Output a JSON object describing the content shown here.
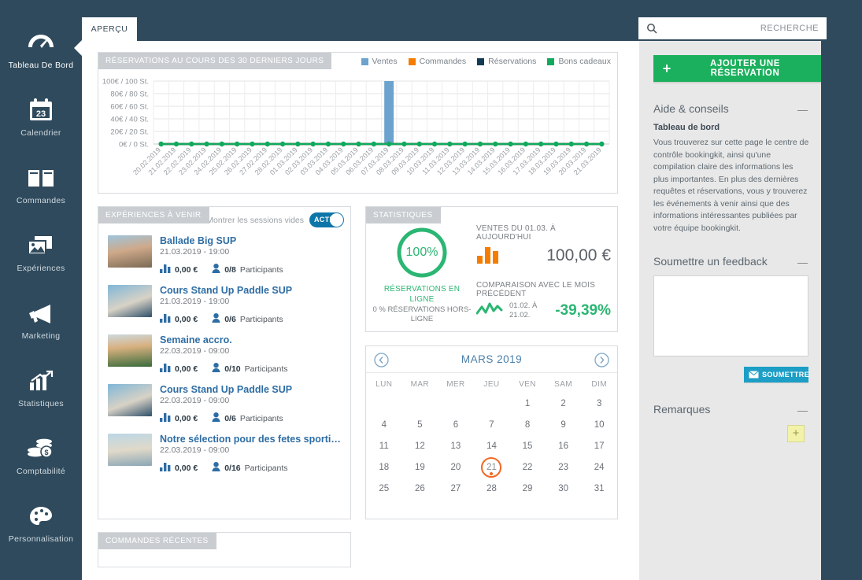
{
  "nav": {
    "items": [
      {
        "label": "Tableau De Bord",
        "icon": "dashboard-gauge-icon",
        "active": true
      },
      {
        "label": "Calendrier",
        "icon": "calendar-icon",
        "active": false
      },
      {
        "label": "Commandes",
        "icon": "book-icon",
        "active": false
      },
      {
        "label": "Expériences",
        "icon": "photos-icon",
        "active": false
      },
      {
        "label": "Marketing",
        "icon": "megaphone-icon",
        "active": false
      },
      {
        "label": "Statistiques",
        "icon": "bar-chart-arrow-icon",
        "active": false
      },
      {
        "label": "Comptabilité",
        "icon": "coins-icon",
        "active": false
      },
      {
        "label": "Personnalisation",
        "icon": "palette-icon",
        "active": false
      }
    ],
    "calendar_day_number": "23"
  },
  "topbar": {
    "tab_label": "APERÇU",
    "search_placeholder": "RECHERCHE",
    "search_value": "",
    "search_icon": "search-icon"
  },
  "chart_panel": {
    "tag": "RÉSERVATIONS AU COURS DES 30 DERNIERS JOURS"
  },
  "chart_data": {
    "type": "bar",
    "title": "RÉSERVATIONS AU COURS DES 30 DERNIERS JOURS",
    "xlabel": "",
    "ylabel": "",
    "ylim": [
      0,
      100
    ],
    "yticks": [
      0,
      20,
      40,
      60,
      80,
      100
    ],
    "ytick_labels": [
      "0€ / 0 St.",
      "20€ / 20 St.",
      "40€ / 40 St.",
      "60€ / 60 St.",
      "80€ / 80 St.",
      "100€ / 100 St."
    ],
    "grid": true,
    "legend_position": "top-right",
    "categories": [
      "20.02.2019",
      "21.02.2019",
      "22.02.2019",
      "23.02.2019",
      "24.02.2019",
      "25.02.2019",
      "26.02.2019",
      "27.02.2019",
      "28.02.2019",
      "01.03.2019",
      "02.03.2019",
      "03.03.2019",
      "04.03.2019",
      "05.03.2019",
      "06.03.2019",
      "07.03.2019",
      "08.03.2019",
      "09.03.2019",
      "10.03.2019",
      "11.03.2019",
      "12.03.2019",
      "13.03.2019",
      "14.03.2019",
      "15.03.2019",
      "16.03.2019",
      "17.03.2019",
      "18.03.2019",
      "19.03.2019",
      "20.03.2019",
      "21.03.2019"
    ],
    "series": [
      {
        "name": "Ventes",
        "color": "#6ba3ce",
        "kind": "bar",
        "values": [
          0,
          0,
          0,
          0,
          0,
          0,
          0,
          0,
          0,
          0,
          0,
          0,
          0,
          0,
          0,
          100,
          0,
          0,
          0,
          0,
          0,
          0,
          0,
          0,
          0,
          0,
          0,
          0,
          0,
          0
        ]
      },
      {
        "name": "Commandes",
        "color": "#f57c00",
        "kind": "line",
        "values": [
          0,
          0,
          0,
          0,
          0,
          0,
          0,
          0,
          0,
          0,
          0,
          0,
          0,
          0,
          0,
          0,
          0,
          0,
          0,
          0,
          0,
          0,
          0,
          0,
          0,
          0,
          0,
          0,
          0,
          0
        ]
      },
      {
        "name": "Réservations",
        "color": "#123a54",
        "kind": "line",
        "values": [
          0,
          0,
          0,
          0,
          0,
          0,
          0,
          0,
          0,
          0,
          0,
          0,
          0,
          0,
          0,
          0,
          0,
          0,
          0,
          0,
          0,
          0,
          0,
          0,
          0,
          0,
          0,
          0,
          0,
          0
        ]
      },
      {
        "name": "Bons cadeaux",
        "color": "#11a95e",
        "kind": "line",
        "values": [
          0,
          0,
          0,
          0,
          0,
          0,
          0,
          0,
          0,
          0,
          0,
          0,
          0,
          0,
          0,
          0,
          0,
          0,
          0,
          0,
          0,
          0,
          0,
          0,
          0,
          0,
          0,
          0,
          0,
          0
        ]
      }
    ]
  },
  "experiences": {
    "tag": "EXPÉRIENCES À VENIR",
    "toggle_label": "Montrer les sessions vides",
    "toggle_state": "ACTIF",
    "items": [
      {
        "title": "Ballade Big SUP",
        "datetime": "21.03.2019 - 19:00",
        "price": "0,00 €",
        "participants": "0/8",
        "participants_label": "Participants",
        "thumb": "surf-group-beach"
      },
      {
        "title": "Cours Stand Up Paddle SUP",
        "datetime": "21.03.2019 - 19:00",
        "price": "0,00 €",
        "participants": "0/6",
        "participants_label": "Participants",
        "thumb": "windsurf-sail"
      },
      {
        "title": "Semaine accro.",
        "datetime": "22.03.2019 - 09:00",
        "price": "0,00 €",
        "participants": "0/10",
        "participants_label": "Participants",
        "thumb": "kids-group-beach"
      },
      {
        "title": "Cours Stand Up Paddle SUP",
        "datetime": "22.03.2019 - 09:00",
        "price": "0,00 €",
        "participants": "0/6",
        "participants_label": "Participants",
        "thumb": "windsurf-sail"
      },
      {
        "title": "Notre sélection pour des fetes sportives: C…",
        "datetime": "22.03.2019 - 09:00",
        "price": "0,00 €",
        "participants": "0/16",
        "participants_label": "Participants",
        "thumb": "paddle-boarder"
      }
    ]
  },
  "statistics": {
    "tag": "STATISTIQUES",
    "donut_value": "100%",
    "donut_percent": 100,
    "donut_caption": "RÉSERVATIONS EN LIGNE",
    "donut_sub": "0 % RÉSERVATIONS HORS-LIGNE",
    "sales_caption": "VENTES DU 01.03. À AUJOURD'HUI",
    "sales_value": "100,00 €",
    "compare_caption": "COMPARAISON AVEC LE MOIS PRÉCÉDENT",
    "compare_range": "01.02. À 21.02.",
    "compare_value": "-39,39%",
    "accent_green": "#2bb673",
    "accent_orange": "#f57c00"
  },
  "calendar": {
    "title": "MARS 2019",
    "prev_icon": "chevron-left-icon",
    "next_icon": "chevron-right-icon",
    "weekdays": [
      "LUN",
      "MAR",
      "MER",
      "JEU",
      "VEN",
      "SAM",
      "DIM"
    ],
    "weeks": [
      [
        "",
        "",
        "",
        "",
        "1",
        "2",
        "3"
      ],
      [
        "4",
        "5",
        "6",
        "7",
        "8",
        "9",
        "10"
      ],
      [
        "11",
        "12",
        "13",
        "14",
        "15",
        "16",
        "17"
      ],
      [
        "18",
        "19",
        "20",
        "21",
        "22",
        "23",
        "24"
      ],
      [
        "25",
        "26",
        "27",
        "28",
        "29",
        "30",
        "31"
      ]
    ],
    "today": "21",
    "today_color": "#f26722"
  },
  "orders": {
    "tag": "COMMANDES RÉCENTES"
  },
  "sidebar": {
    "add_button_label": "AJOUTER UNE RÉSERVATION",
    "add_button_icon": "plus-icon",
    "add_button_color": "#1bb05d",
    "help": {
      "title": "Aide & conseils",
      "collapse_icon": "minus-icon",
      "subtitle": "Tableau de bord",
      "body": "Vous trouverez sur cette page le centre de contrôle bookingkit, ainsi qu'une compilation claire des informations les plus importantes. En plus des dernières requêtes et réservations, vous y trouverez les événements à venir ainsi que des informations intéressantes publiées par votre équipe bookingkit."
    },
    "feedback": {
      "title": "Soumettre un feedback",
      "collapse_icon": "minus-icon",
      "textarea_value": "",
      "submit_label": "SOUMETTRE",
      "submit_icon": "envelope-icon"
    },
    "notes": {
      "title": "Remarques",
      "collapse_icon": "minus-icon",
      "add_label": "+"
    }
  }
}
